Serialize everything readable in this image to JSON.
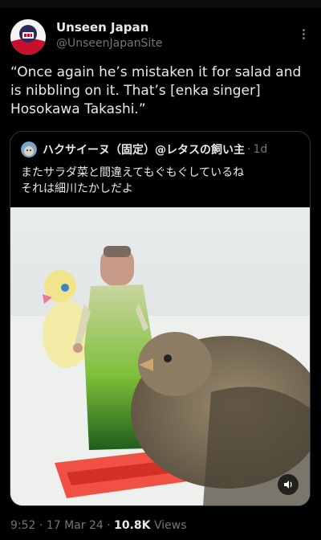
{
  "author": {
    "display_name": "Unseen Japan",
    "handle": "@UnseenJapanSite"
  },
  "post": {
    "text": "“Once again he’s mistaken it for salad and is nibbling on it. That’s [enka singer] Hosokawa Takashi.”"
  },
  "quoted_post": {
    "author_name": "ハクサイーヌ（固定）@レタスの飼い主",
    "separator": "·",
    "time": "1d",
    "line1": "またサラダ菜と間違えてもぐもぐしているね",
    "line2": "それは細川たかしだよ"
  },
  "meta": {
    "time": "9:52",
    "sep1": " · ",
    "date": "17 Mar 24",
    "sep2": " · ",
    "views_count": "10.8K",
    "views_label": " Views"
  },
  "icons": {
    "more": "more-dots-icon",
    "sound": "speaker-icon"
  },
  "colors": {
    "background": "#000000",
    "text": "#e7e9ea",
    "muted": "#71767b",
    "border": "#2f3336"
  }
}
